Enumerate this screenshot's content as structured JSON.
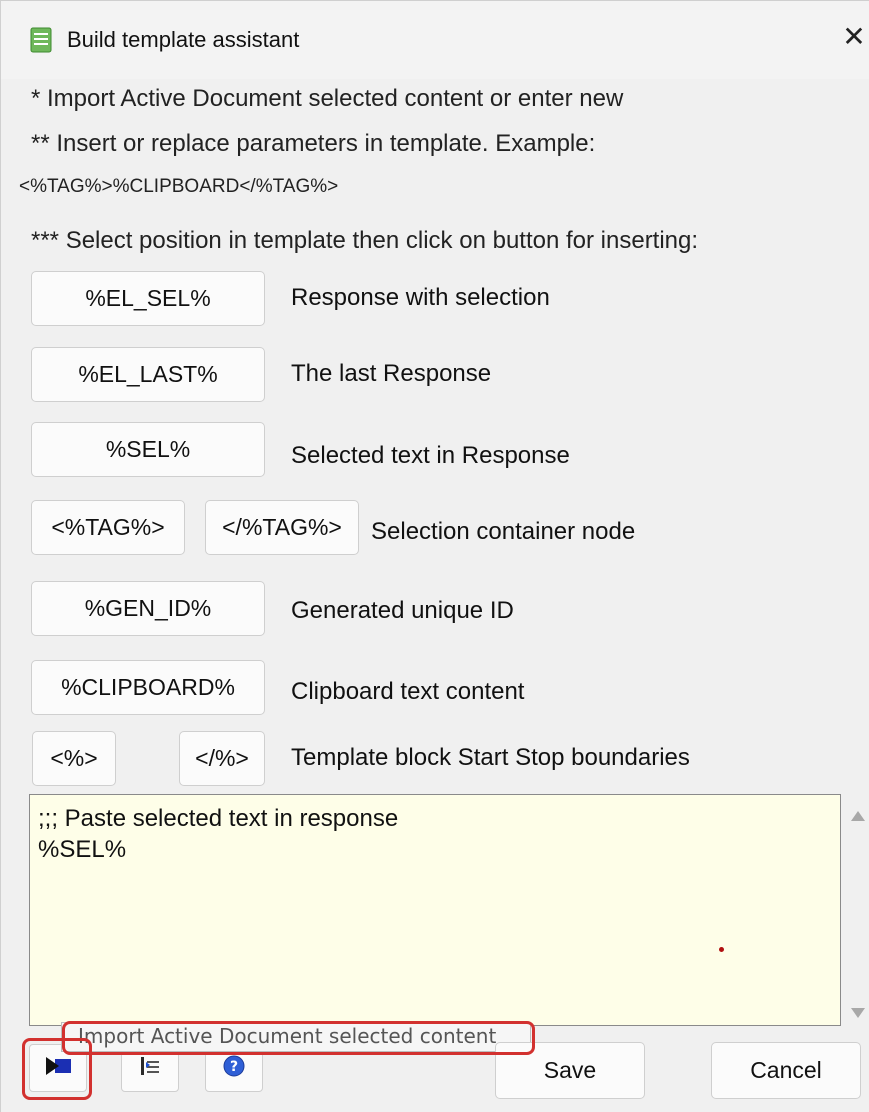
{
  "window": {
    "title": "Build template assistant"
  },
  "notes": {
    "line1": "*  Import Active Document selected content or enter new",
    "line2": "** Insert or replace parameters in template. Example:",
    "example": "<%TAG%>%CLIPBOARD</%TAG%>",
    "line3": "*** Select position in template then click on button for inserting:"
  },
  "params": [
    {
      "button": "%EL_SEL%",
      "label": "Response with selection"
    },
    {
      "button": "%EL_LAST%",
      "label": "The last Response"
    },
    {
      "button": "%SEL%",
      "label": "Selected text in Response"
    },
    {
      "button_open": "<%TAG%>",
      "button_close": "</%TAG%>",
      "label": "Selection container node"
    },
    {
      "button": "%GEN_ID%",
      "label": "Generated unique ID"
    },
    {
      "button": "%CLIPBOARD%",
      "label": "Clipboard text content"
    },
    {
      "button_open": "<%>",
      "button_close": "</%>",
      "label": "Template block Start Stop boundaries"
    }
  ],
  "editor": {
    "content": ";;; Paste selected text in response\n%SEL%"
  },
  "tooltip": "Import Active Document selected content",
  "footer": {
    "save_label": "Save",
    "cancel_label": "Cancel"
  },
  "icons": [
    "document-icon",
    "close-icon",
    "import-arrow-icon",
    "insert-list-icon",
    "help-icon",
    "scroll-up-arrow-icon",
    "scroll-down-arrow-icon"
  ],
  "colors": {
    "editor_bg": "#fefee8",
    "highlight": "#d2312f",
    "window_bg": "#f0f0f0"
  }
}
